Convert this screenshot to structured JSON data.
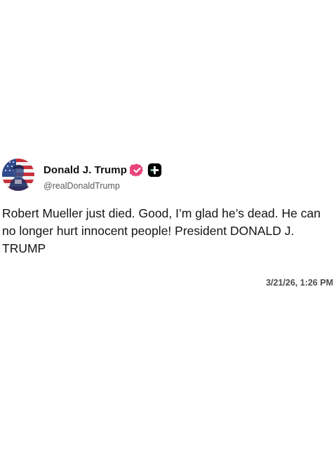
{
  "post": {
    "author": {
      "display_name": "Donald J. Trump",
      "handle": "@realDonaldTrump",
      "avatar_icon": "flag-portrait-avatar",
      "verified_badge_icon": "verified-check-icon",
      "verified_badge_color": "#e8457a",
      "platform_badge_icon": "truth-social-plus-icon",
      "platform_badge_color": "#000000"
    },
    "text": "Robert Mueller just died. Good, I’m glad he’s dead. He can no longer hurt innocent people! President DONALD J. TRUMP",
    "timestamp": "3/21/26, 1:26 PM"
  }
}
